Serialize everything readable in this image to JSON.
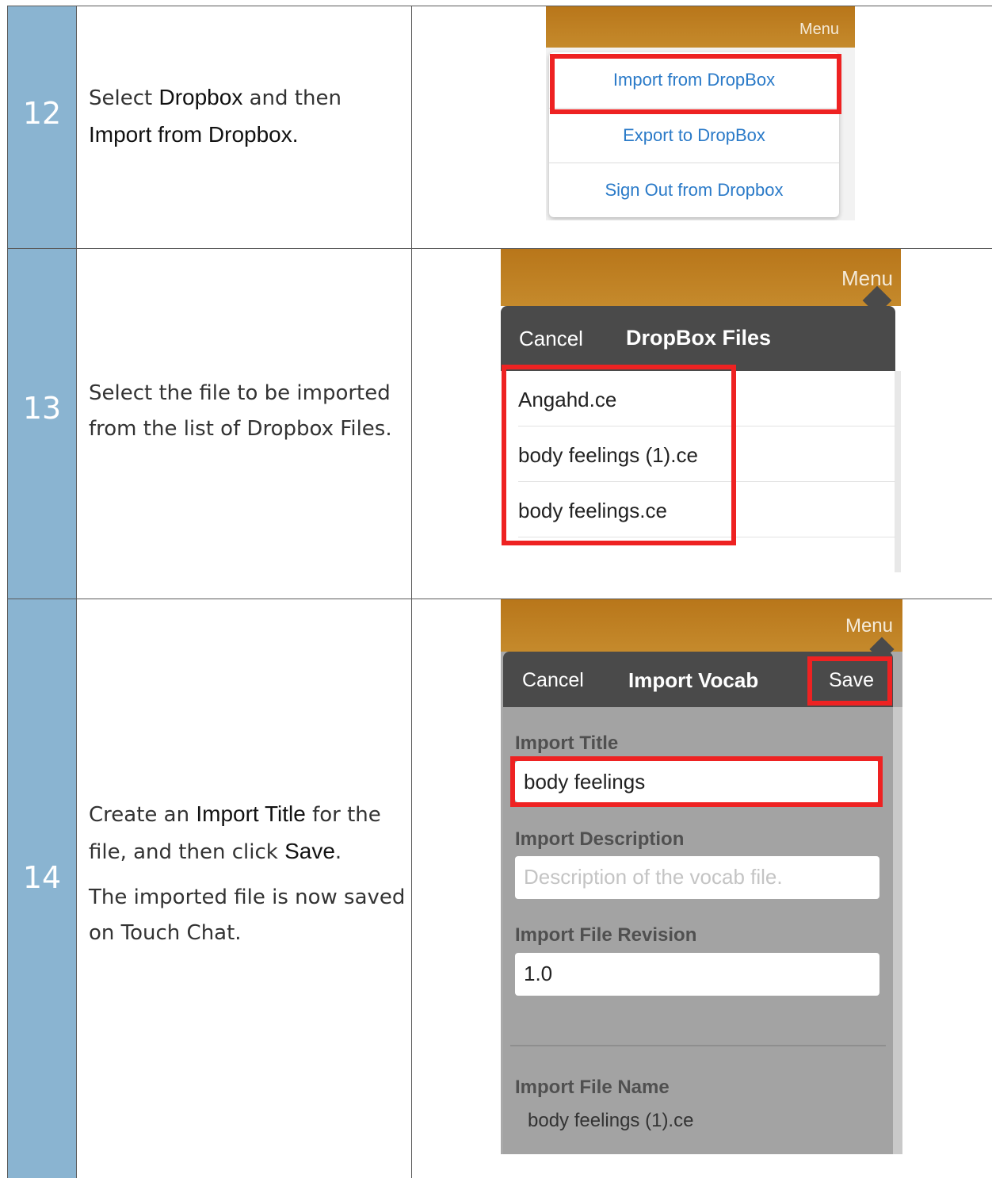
{
  "steps": [
    {
      "number": "12",
      "text": {
        "p1": "Select ",
        "b1": "Dropbox",
        "p2": " and then",
        "b2": "Import from Dropbox."
      },
      "screenshot": {
        "menu_label": "Menu",
        "items": [
          "Import from DropBox",
          "Export to DropBox",
          "Sign Out from Dropbox"
        ]
      }
    },
    {
      "number": "13",
      "text": {
        "line1": "Select the file to be imported",
        "line2": "from the list of Dropbox Files."
      },
      "screenshot": {
        "menu_label": "Menu",
        "cancel": "Cancel",
        "title": "DropBox Files",
        "files": [
          "Angahd.ce",
          "body feelings (1).ce",
          "body feelings.ce"
        ]
      }
    },
    {
      "number": "14",
      "text": {
        "p1": "Create an ",
        "b1": "Import Title",
        "p2": " for the",
        "p3": "file, and then click ",
        "b2": "Save",
        "p4": ".",
        "para2_line1": "The imported file is now saved",
        "para2_line2": "on Touch Chat."
      },
      "screenshot": {
        "menu_label": "Menu",
        "cancel": "Cancel",
        "title": "Import Vocab",
        "save": "Save",
        "import_title_label": "Import Title",
        "import_title_value": "body feelings",
        "import_description_label": "Import Description",
        "import_description_placeholder": "Description of the vocab file.",
        "import_revision_label": "Import File Revision",
        "import_revision_value": "1.0",
        "import_file_name_label": "Import File Name",
        "import_file_name_value": "body feelings (1).ce"
      }
    }
  ],
  "colors": {
    "step_column": "#8ab4d1",
    "navbar": "#bd7e22",
    "highlight": "#ee2222",
    "ios_link": "#2a7ac8"
  }
}
